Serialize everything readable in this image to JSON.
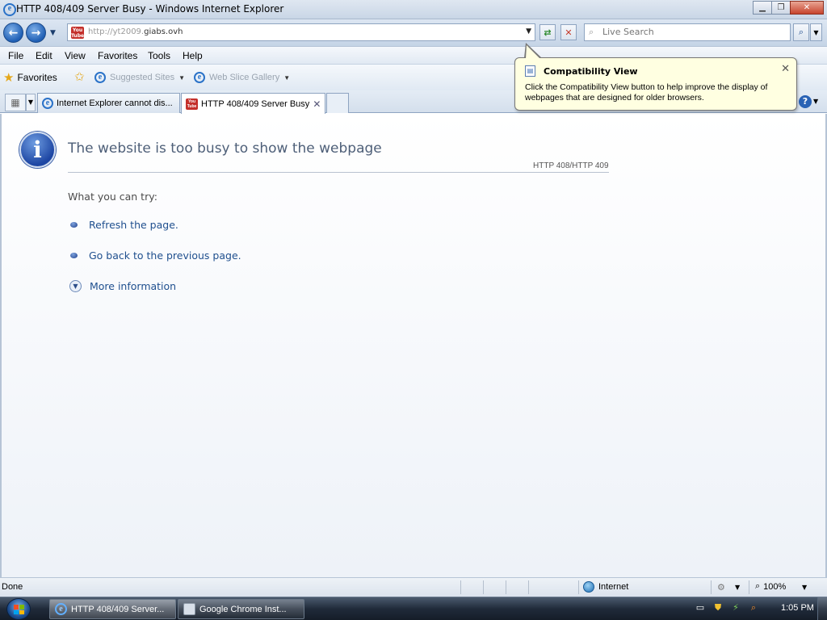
{
  "window": {
    "title": "HTTP 408/409 Server Busy - Windows Internet Explorer",
    "icon": "ie-icon",
    "controls": [
      "minimize",
      "restore",
      "close"
    ]
  },
  "address_bar": {
    "url_prefix": "http://yt2009.",
    "url_domain": "giabs.ovh",
    "favicon": "youtube-favicon",
    "favicon_text_top": "You",
    "favicon_text_bottom": "Tube"
  },
  "search": {
    "placeholder": "Live Search"
  },
  "menu": {
    "items": [
      "File",
      "Edit",
      "View",
      "Favorites",
      "Tools",
      "Help"
    ]
  },
  "favorites_bar": {
    "favorites_label": "Favorites",
    "links": [
      "Suggested Sites",
      "Web Slice Gallery"
    ]
  },
  "tabs": [
    {
      "label": "Internet Explorer cannot dis...",
      "icon": "ie-icon",
      "active": false
    },
    {
      "label": "HTTP 408/409 Server Busy",
      "icon": "youtube-favicon",
      "active": true
    }
  ],
  "compat_callout": {
    "title": "Compatibility View",
    "text": "Click the Compatibility View button to help improve the display of webpages that are designed for older browsers."
  },
  "page": {
    "title": "The website is too busy to show the webpage",
    "error_code": "HTTP 408/HTTP 409",
    "try_label": "What you can try:",
    "suggestions": [
      "Refresh the page.",
      "Go back to the previous page."
    ],
    "more_info": "More information"
  },
  "status_bar": {
    "status": "Done",
    "zone": "Internet",
    "zoom": "100%"
  },
  "taskbar": {
    "buttons": [
      {
        "label": "HTTP 408/409 Server...",
        "icon": "ie-icon",
        "active": true
      },
      {
        "label": "Google Chrome Inst...",
        "icon": "installer-icon",
        "active": false
      }
    ],
    "clock": "1:05 PM"
  },
  "colors": {
    "link": "#1f4f8e",
    "title_text": "#4e5f78",
    "callout_bg": "#ffffe1",
    "taskbar": "#202b3a"
  }
}
